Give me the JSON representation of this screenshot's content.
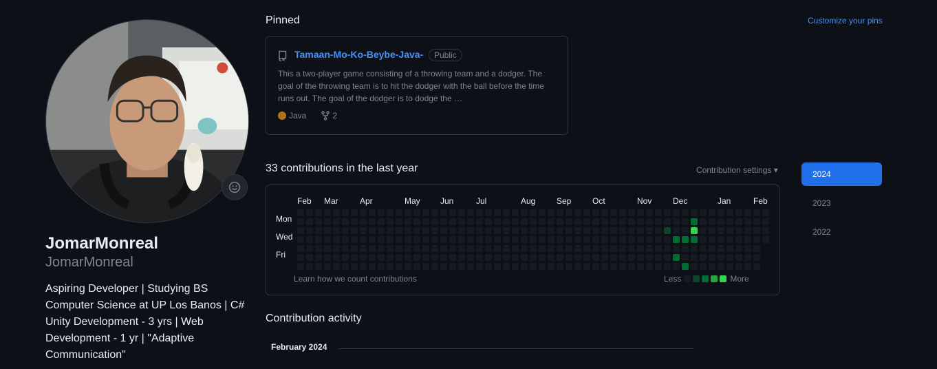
{
  "profile": {
    "fullname": "JomarMonreal",
    "username": "JomarMonreal",
    "bio": "Aspiring Developer | Studying BS Computer Science at UP Los Banos | C# Unity Development - 3 yrs | Web Development - 1 yr | \"Adaptive Communication\"",
    "status_icon": "smiley-icon"
  },
  "pinned": {
    "title": "Pinned",
    "customize_label": "Customize your pins",
    "repo": {
      "name": "Tamaan-Mo-Ko-Beybe-Java-",
      "visibility": "Public",
      "description": "This a two-player game consisting of a throwing team and a dodger. The goal of the throwing team is to hit the dodger with the ball before the time runs out. The goal of the dodger is to dodge the …",
      "language": "Java",
      "language_color": "#b07219",
      "forks": "2"
    }
  },
  "contributions": {
    "title": "33 contributions in the last year",
    "settings_label": "Contribution settings ▾",
    "months": [
      "Feb",
      "Mar",
      "Apr",
      "May",
      "Jun",
      "Jul",
      "Aug",
      "Sep",
      "Oct",
      "Nov",
      "Dec",
      "Jan",
      "Feb"
    ],
    "days": [
      "Mon",
      "Wed",
      "Fri"
    ],
    "learn_label": "Learn how we count contributions",
    "legend_less": "Less",
    "legend_more": "More",
    "level_colors": [
      "#161b22",
      "#0e4429",
      "#006d32",
      "#26a641",
      "#39d353"
    ],
    "active_days": [
      {
        "week": 41,
        "day": 2,
        "level": 1
      },
      {
        "week": 42,
        "day": 3,
        "level": 2
      },
      {
        "week": 42,
        "day": 5,
        "level": 2
      },
      {
        "week": 43,
        "day": 3,
        "level": 2
      },
      {
        "week": 43,
        "day": 6,
        "level": 2
      },
      {
        "week": 44,
        "day": 1,
        "level": 2
      },
      {
        "week": 44,
        "day": 2,
        "level": 4
      },
      {
        "week": 44,
        "day": 3,
        "level": 2
      }
    ]
  },
  "years": [
    "2024",
    "2023",
    "2022"
  ],
  "activity": {
    "title": "Contribution activity",
    "month": "February 2024"
  }
}
